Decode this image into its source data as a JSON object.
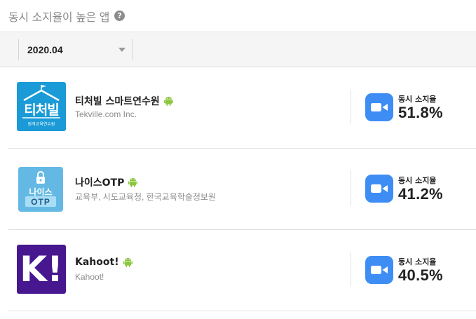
{
  "header": {
    "title": "동시 소지율이 높은 앱",
    "help_icon": "question-circle-icon",
    "help_glyph": "?"
  },
  "filter": {
    "period": "2020.04",
    "dropdown_icon": "caret-down-icon"
  },
  "apps": [
    {
      "name": "티처빌 스마트연수원",
      "developer": "Tekville.com Inc.",
      "platform_icon": "android-icon",
      "icon_text": "티처빌",
      "icon_subtext": "원격교육연수원",
      "metric_icon": "zoom-video-camera-icon",
      "metric_label": "동시 소지율",
      "metric_value": "51.8%"
    },
    {
      "name": "나이스OTP",
      "developer": "교육부, 시도교육청, 한국교육학술정보원",
      "platform_icon": "android-icon",
      "icon_text": "나이스",
      "icon_subtext": "OTP",
      "metric_icon": "zoom-video-camera-icon",
      "metric_label": "동시 소지율",
      "metric_value": "41.2%"
    },
    {
      "name": "Kahoot!",
      "developer": "Kahoot!",
      "platform_icon": "android-icon",
      "icon_text": "K!",
      "metric_icon": "zoom-video-camera-icon",
      "metric_label": "동시 소지율",
      "metric_value": "40.5%"
    }
  ],
  "colors": {
    "android": "#8cc63f",
    "zoom": "#3e8df5",
    "tekville": "#1a9ad6",
    "neis": "#64b9e4",
    "kahoot": "#46178f"
  }
}
